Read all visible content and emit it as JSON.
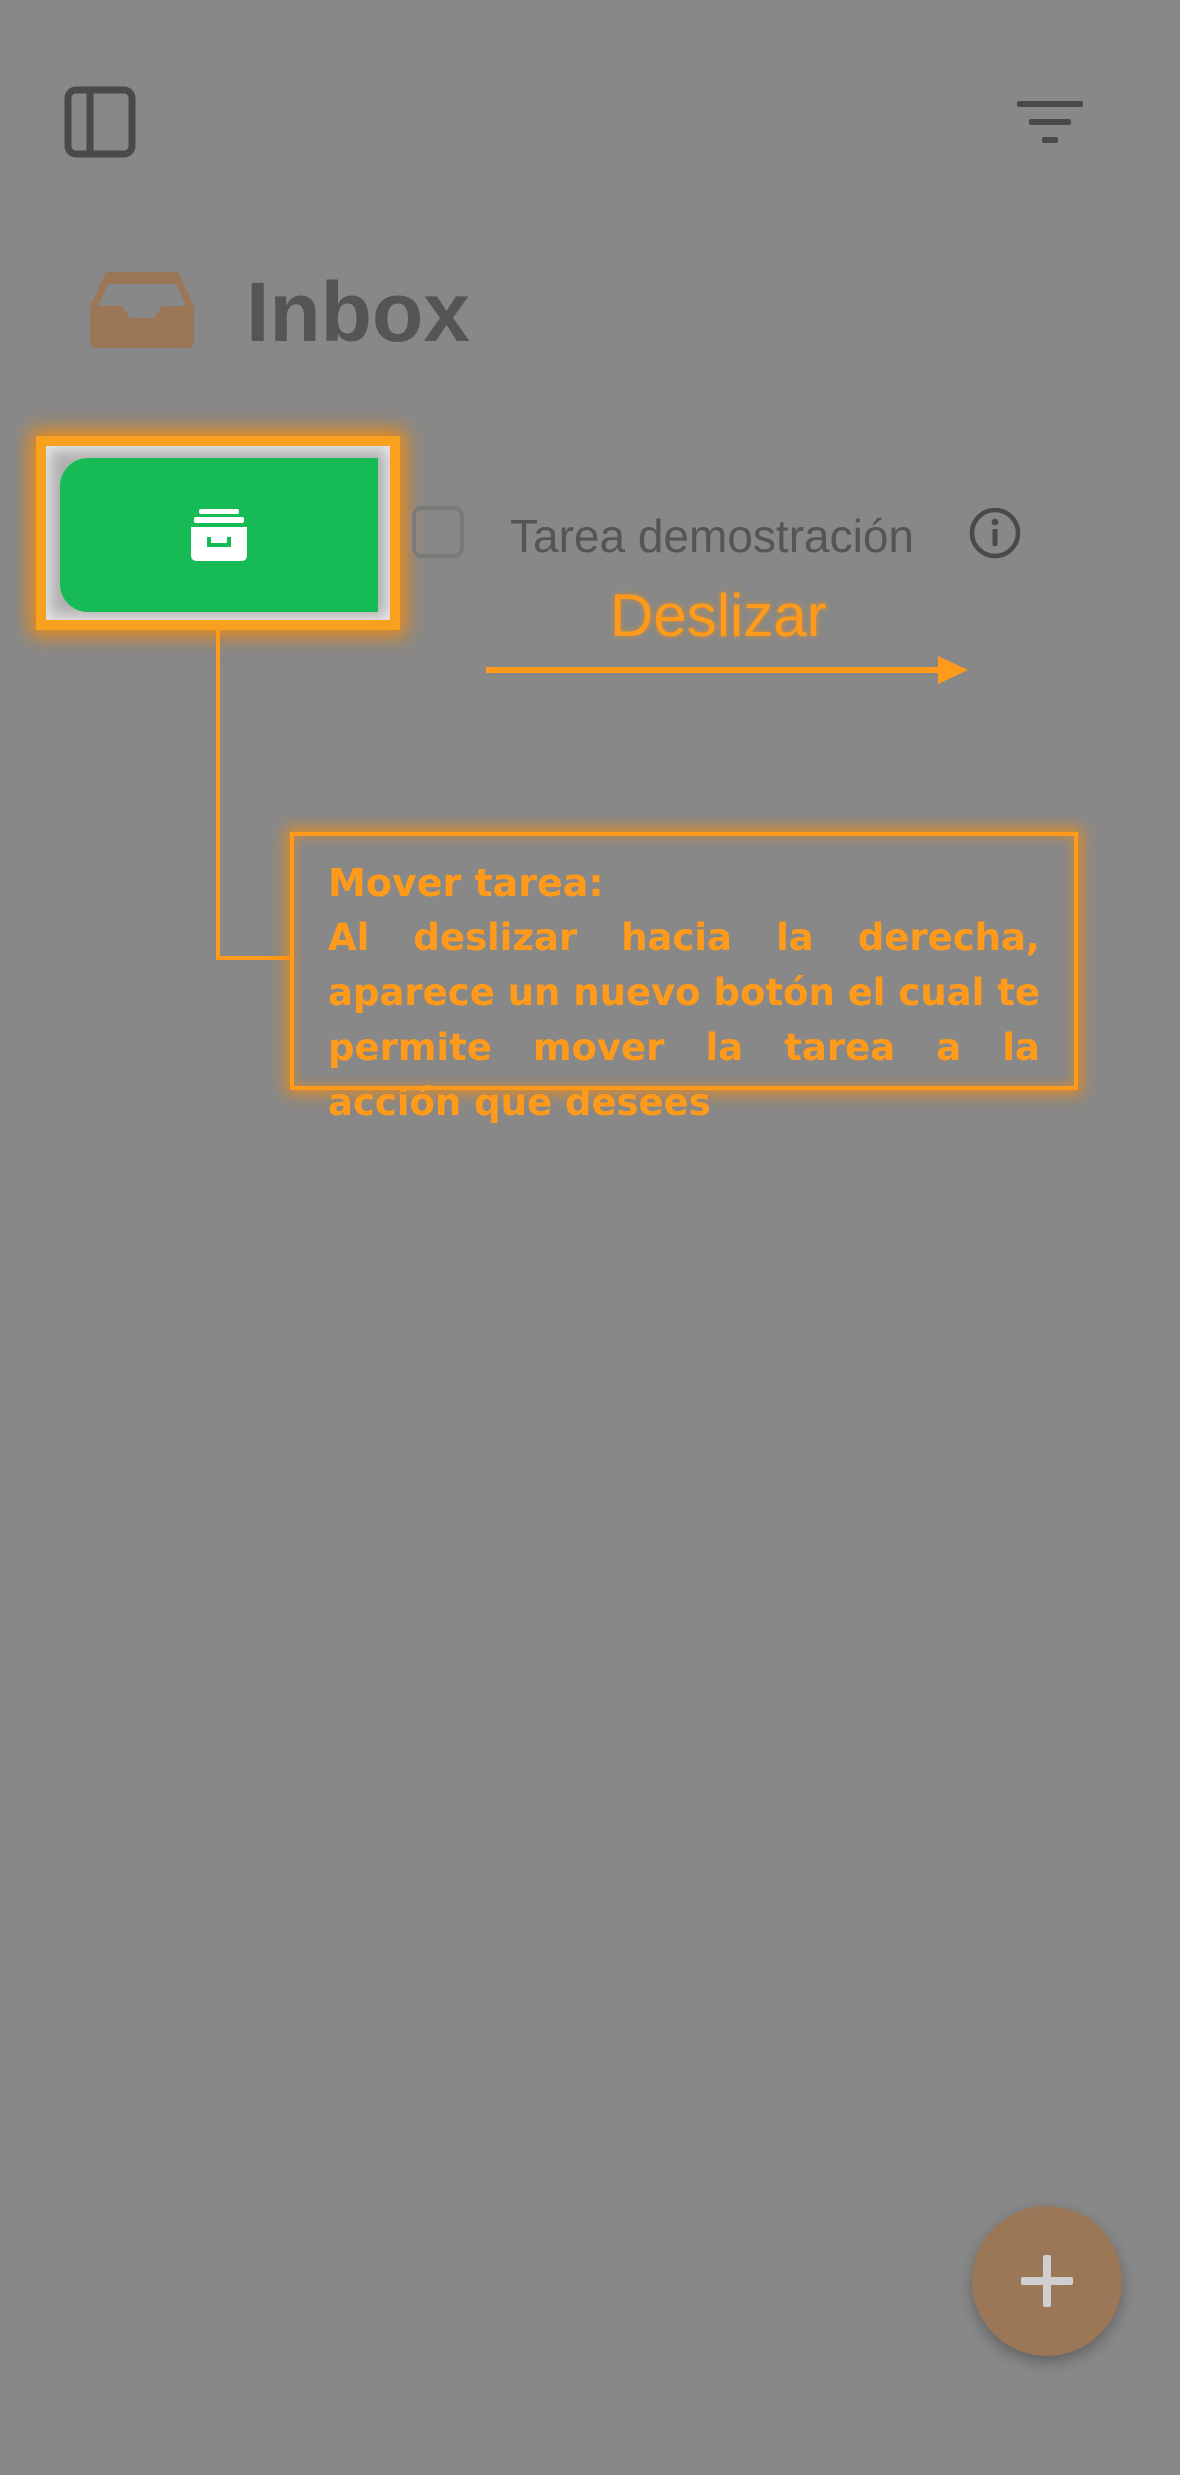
{
  "header": {
    "sidebar_icon": "sidebar-toggle-icon",
    "filter_icon": "filter-icon"
  },
  "page": {
    "title": "Inbox",
    "title_icon": "inbox-tray-icon"
  },
  "task": {
    "title": "Tarea demostración",
    "checked": false,
    "info_icon": "info-icon"
  },
  "swipe_action": {
    "icon": "archive-box-icon",
    "color": "#17bb56"
  },
  "tutorial": {
    "swipe_label": "Deslizar",
    "callout_title": "Mover tarea:",
    "callout_body": "Al deslizar hacia la derecha, aparece un nuevo botón el cual te permite mover la tarea a la acción que desees",
    "accent_color": "#ff9a1a"
  },
  "fab": {
    "icon": "plus-icon",
    "color": "#9b7757"
  }
}
